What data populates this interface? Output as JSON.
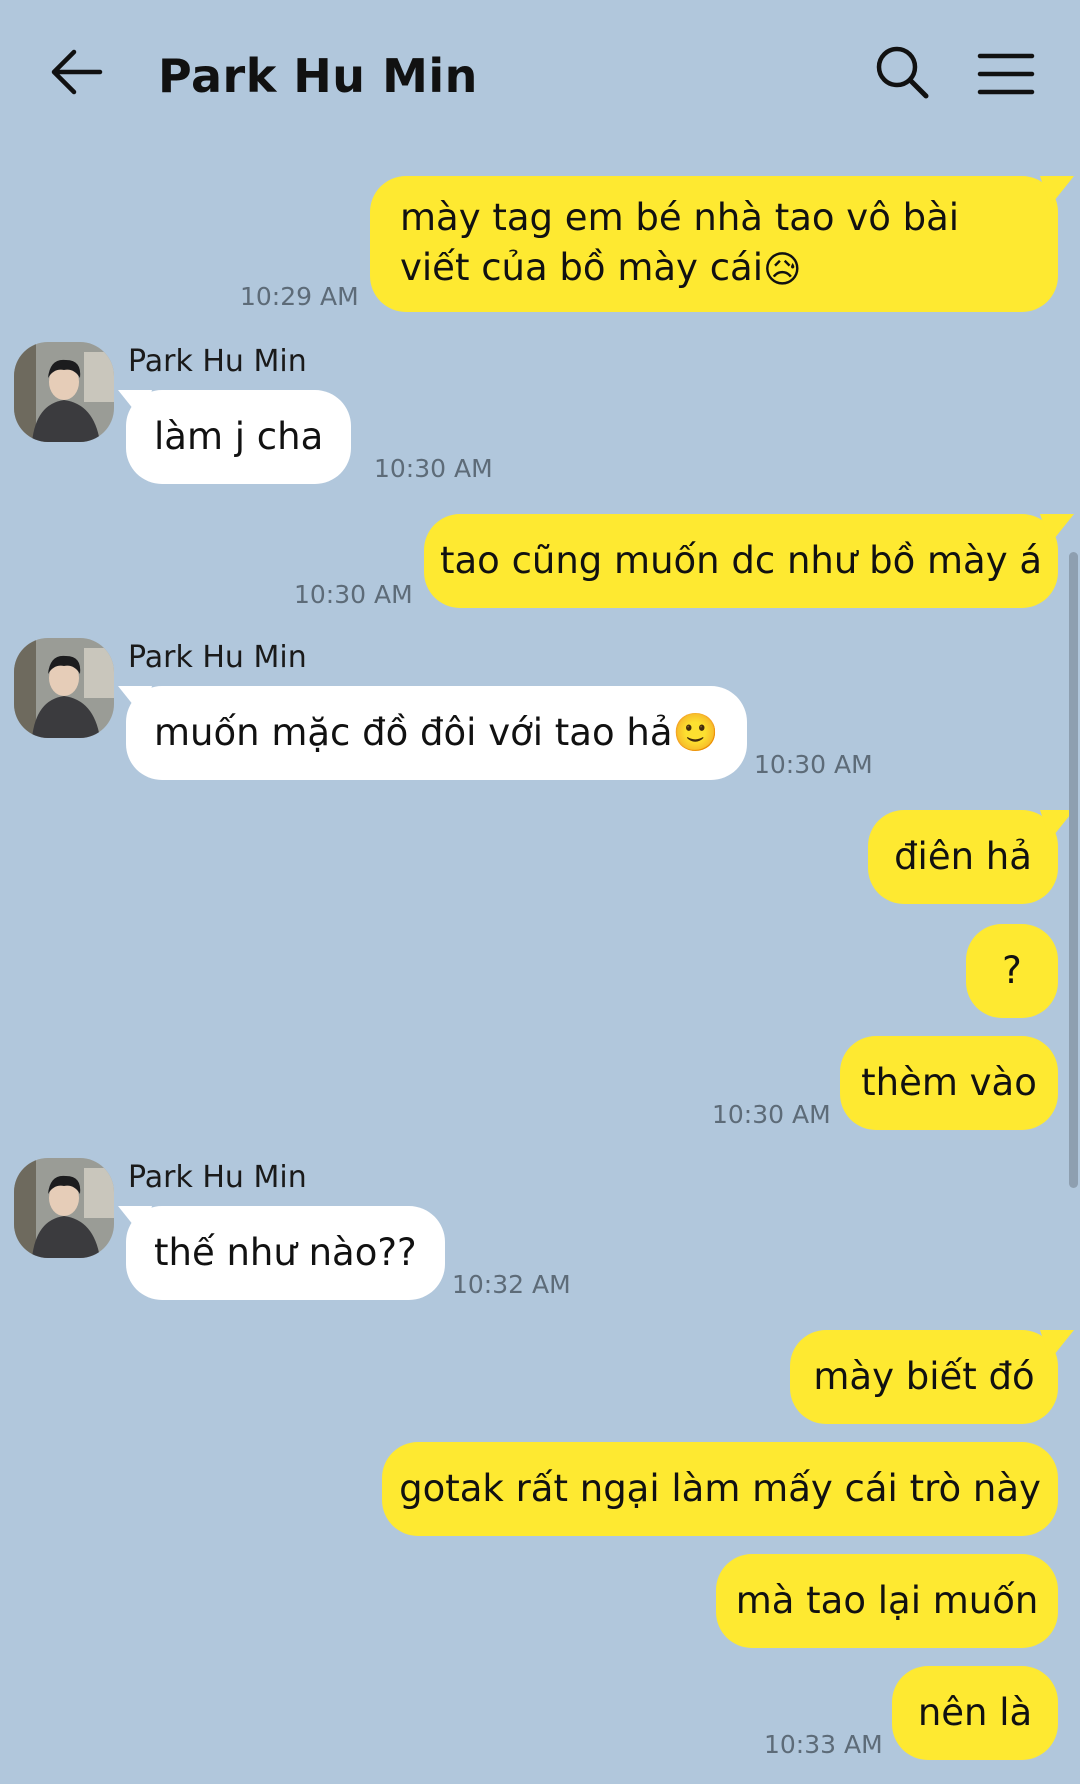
{
  "header": {
    "title": "Park Hu Min",
    "back_icon": "arrow-left-icon",
    "search_icon": "search-icon",
    "menu_icon": "hamburger-menu-icon"
  },
  "colors": {
    "background": "#b1c7dc",
    "outgoing_bubble": "#fee931",
    "incoming_bubble": "#ffffff",
    "timestamp": "#5d6b78"
  },
  "messages": [
    {
      "from": "me",
      "text": "mày tag em bé nhà tao vô bài viết của bồ mày cái",
      "emoji": "😥",
      "time": "10:29 AM"
    },
    {
      "from": "them",
      "sender": "Park Hu Min",
      "text": "làm j cha",
      "time": "10:30 AM"
    },
    {
      "from": "me",
      "text": "tao cũng muốn dc như bồ mày á",
      "time": "10:30 AM"
    },
    {
      "from": "them",
      "sender": "Park Hu Min",
      "text": "muốn mặc đồ đôi với tao hả",
      "emoji": "🙂",
      "time": "10:30 AM"
    },
    {
      "from": "me",
      "text": "điên hả"
    },
    {
      "from": "me",
      "text": "?"
    },
    {
      "from": "me",
      "text": "thèm vào",
      "time": "10:30 AM"
    },
    {
      "from": "them",
      "sender": "Park Hu Min",
      "text": "thế như nào??",
      "time": "10:32 AM"
    },
    {
      "from": "me",
      "text": "mày biết đó"
    },
    {
      "from": "me",
      "text": "gotak rất ngại làm mấy cái trò này"
    },
    {
      "from": "me",
      "text": "mà tao lại muốn"
    },
    {
      "from": "me",
      "text": "nên là",
      "time": "10:33 AM"
    }
  ]
}
